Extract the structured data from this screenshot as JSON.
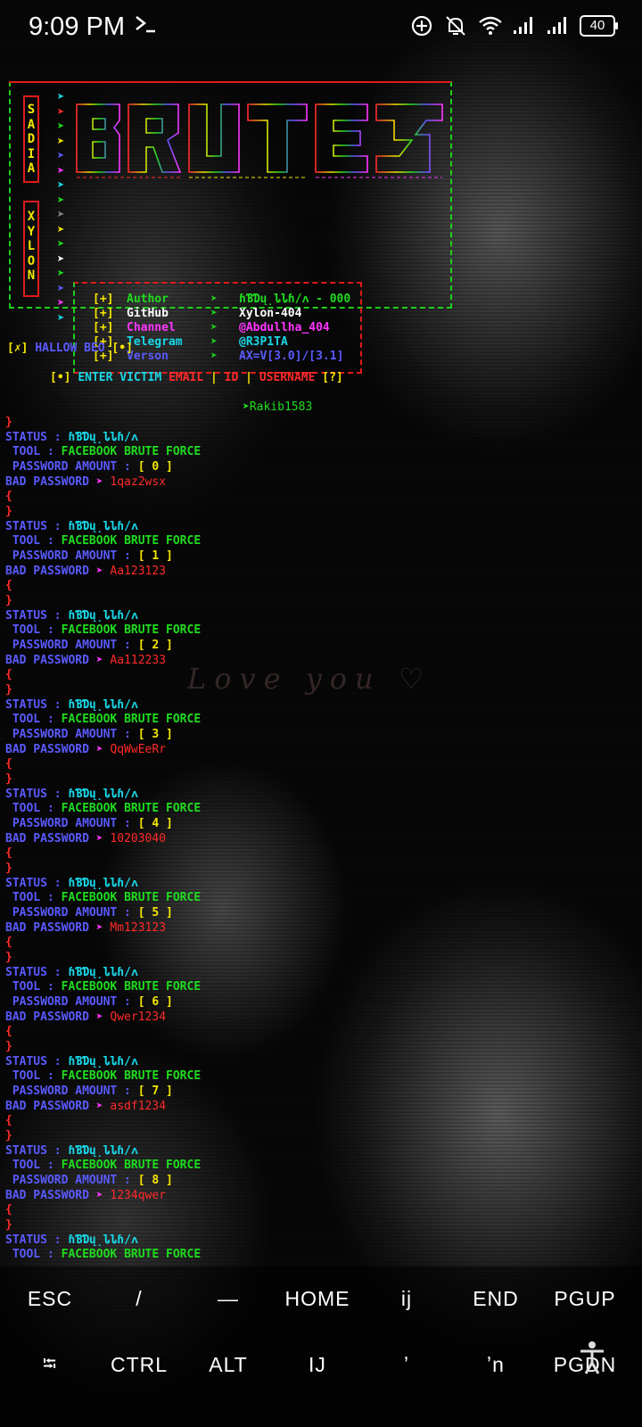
{
  "status_bar": {
    "time": "9:09 PM",
    "terminal_icon": "terminal-prompt-icon",
    "icons": [
      "data-saver-icon",
      "notifications-off-icon",
      "wifi-icon",
      "signal-icon",
      "signal-icon"
    ],
    "battery": "40"
  },
  "banner": {
    "left_top": [
      "S",
      "A",
      "D",
      "I",
      "A"
    ],
    "left_bottom": [
      "X",
      "Y",
      "L",
      "O",
      "N"
    ],
    "logo_text": "BRUTE",
    "info": [
      {
        "bracket": "[+]",
        "label": "Author",
        "value": "ɦƁƊų̣ȴȴɦ/ᴧ - 000",
        "label_color": "#1fdc1f",
        "value_color": "#1fdc1f"
      },
      {
        "bracket": "[+]",
        "label": "GitHub",
        "value": "Xylon-404",
        "label_color": "#ffffff",
        "value_color": "#ffffff"
      },
      {
        "bracket": "[+]",
        "label": "Channel",
        "value": "@Abdullha_404",
        "label_color": "#ff35ff",
        "value_color": "#ff35ff"
      },
      {
        "bracket": "[+]",
        "label": "Telegram",
        "value": "@R3P1TA",
        "label_color": "#18d8e8",
        "value_color": "#18d8e8"
      },
      {
        "bracket": "[+]",
        "label": "Verson",
        "value": "AX=V[3.0]/[3.1]",
        "label_color": "#5a5aff",
        "value_color": "#5a5aff"
      }
    ]
  },
  "hello_line": {
    "open": "[✗]",
    "text": "HALLOW BEO",
    "close": "[•]"
  },
  "enter_line": {
    "open": "[•]",
    "part1": "ENTER VICTIM",
    "part2": "EMAIL",
    "sep": "|",
    "part3": "ID",
    "part4": "USERNAME",
    "close": "[?]"
  },
  "input_value": "➤Rakib1583",
  "labels": {
    "status": "STATUS :",
    "status_value": "ɦƁƊų̣ȴȴɦ/ᴧ",
    "tool": " TOOL :",
    "tool_value": "FACEBOOK BRUTE FORCE",
    "amount": " PASSWORD AMOUNT :",
    "bad": "BAD PASSWORD",
    "arrow": "➤",
    "open_brace": "{",
    "close_brace": "}"
  },
  "attempts": [
    {
      "amount": "[ 0 ]",
      "password": "1qaz2wsx"
    },
    {
      "amount": "[ 1 ]",
      "password": "Aa123123"
    },
    {
      "amount": "[ 2 ]",
      "password": "Aa112233"
    },
    {
      "amount": "[ 3 ]",
      "password": "QqWwEeRr"
    },
    {
      "amount": "[ 4 ]",
      "password": "10203040"
    },
    {
      "amount": "[ 5 ]",
      "password": "Mm123123"
    },
    {
      "amount": "[ 6 ]",
      "password": "Qwer1234"
    },
    {
      "amount": "[ 7 ]",
      "password": "asdf1234"
    },
    {
      "amount": "[ 8 ]",
      "password": "1234qwer"
    }
  ],
  "background_text": "Love you ♡",
  "extra_keys": {
    "row1": [
      "ESC",
      "/",
      "—",
      "HOME",
      "ij",
      "END",
      "PGUP"
    ],
    "row2": [
      "⭾",
      "CTRL",
      "ALT",
      "IJ",
      "ʼ",
      "ʼn",
      "PGDN"
    ]
  }
}
